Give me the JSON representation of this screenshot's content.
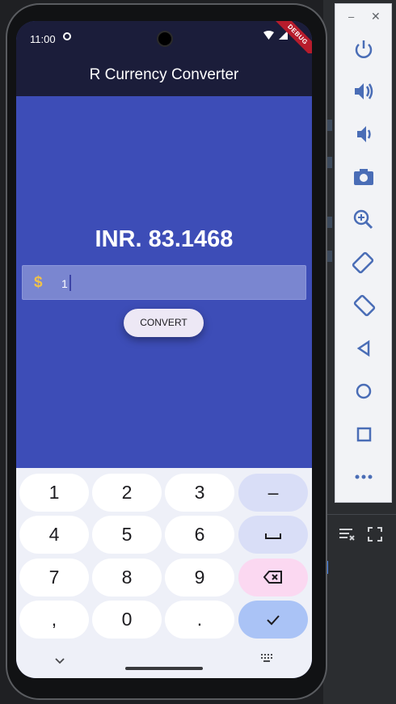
{
  "status": {
    "time": "11:00",
    "debug": "DEBUG"
  },
  "app": {
    "title": "R Currency Converter"
  },
  "result": {
    "text": "INR. 83.1468"
  },
  "input": {
    "prefix_icon": "dollar-icon",
    "value": "1"
  },
  "convert": {
    "label": "CONVERT"
  },
  "keyboard": {
    "rows": [
      [
        "1",
        "2",
        "3",
        "–"
      ],
      [
        "4",
        "5",
        "6",
        "␣"
      ],
      [
        "7",
        "8",
        "9",
        "⌫"
      ],
      [
        ",",
        "0",
        ".",
        "✓"
      ]
    ]
  },
  "emulator": {
    "controls": [
      "power-icon",
      "volume-up-icon",
      "volume-down-icon",
      "camera-icon",
      "zoom-icon",
      "rotate-left-icon",
      "rotate-right-icon",
      "back-icon",
      "home-icon",
      "overview-icon",
      "more-icon"
    ]
  },
  "colors": {
    "app_background": "#3d4db7",
    "app_bar": "#1b1d3a",
    "input_fill": "#7a86d0",
    "dollar": "#f0c14a",
    "emulator_icon": "#4a6db6"
  }
}
